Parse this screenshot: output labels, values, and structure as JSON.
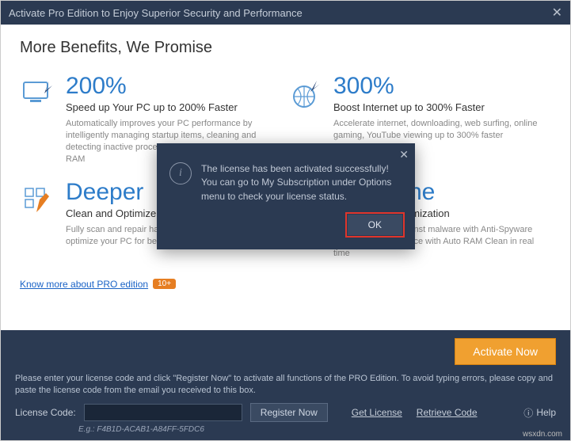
{
  "titlebar": {
    "title": "Activate Pro Edition to Enjoy Superior Security and Performance"
  },
  "heading": "More Benefits, We Promise",
  "benefits": [
    {
      "big": "200%",
      "sub": "Speed up Your PC up to 200% Faster",
      "desc": "Automatically improves your PC performance by intelligently managing startup items, cleaning and detecting inactive processes, and freeing RAM as RAM"
    },
    {
      "big": "300%",
      "sub": "Boost Internet up to 300% Faster",
      "desc": "Accelerate internet, downloading, web surfing, online gaming, YouTube viewing up to 300% faster"
    },
    {
      "big": "Deeper",
      "sub": "Clean and Optimize",
      "desc": "Fully scan and repair hard drive problems and optimize your PC for better performance"
    },
    {
      "big": "Real-time",
      "sub": "Protection & Optimization",
      "desc": "Protect your PC against malware with Anti-Spyware and boost performance with Auto RAM Clean in real time"
    }
  ],
  "know_more": {
    "text": "Know more about PRO edition",
    "badge": "10+"
  },
  "footer": {
    "activate": "Activate Now",
    "instruction": "Please enter your license code and click \"Register Now\" to activate all functions of the PRO Edition. To avoid typing errors, please copy and paste the license code from the email you received to this box.",
    "license_label": "License Code:",
    "license_value": "",
    "register": "Register Now",
    "get_license": "Get License",
    "retrieve": "Retrieve Code",
    "help": "Help",
    "eg": "E.g.: F4B1D-ACAB1-A84FF-5FDC6"
  },
  "modal": {
    "line1": "The license has been activated successfully!",
    "line2": "You can go to My Subscription under Options menu to check your license status.",
    "ok": "OK"
  },
  "watermark": "wsxdn.com"
}
